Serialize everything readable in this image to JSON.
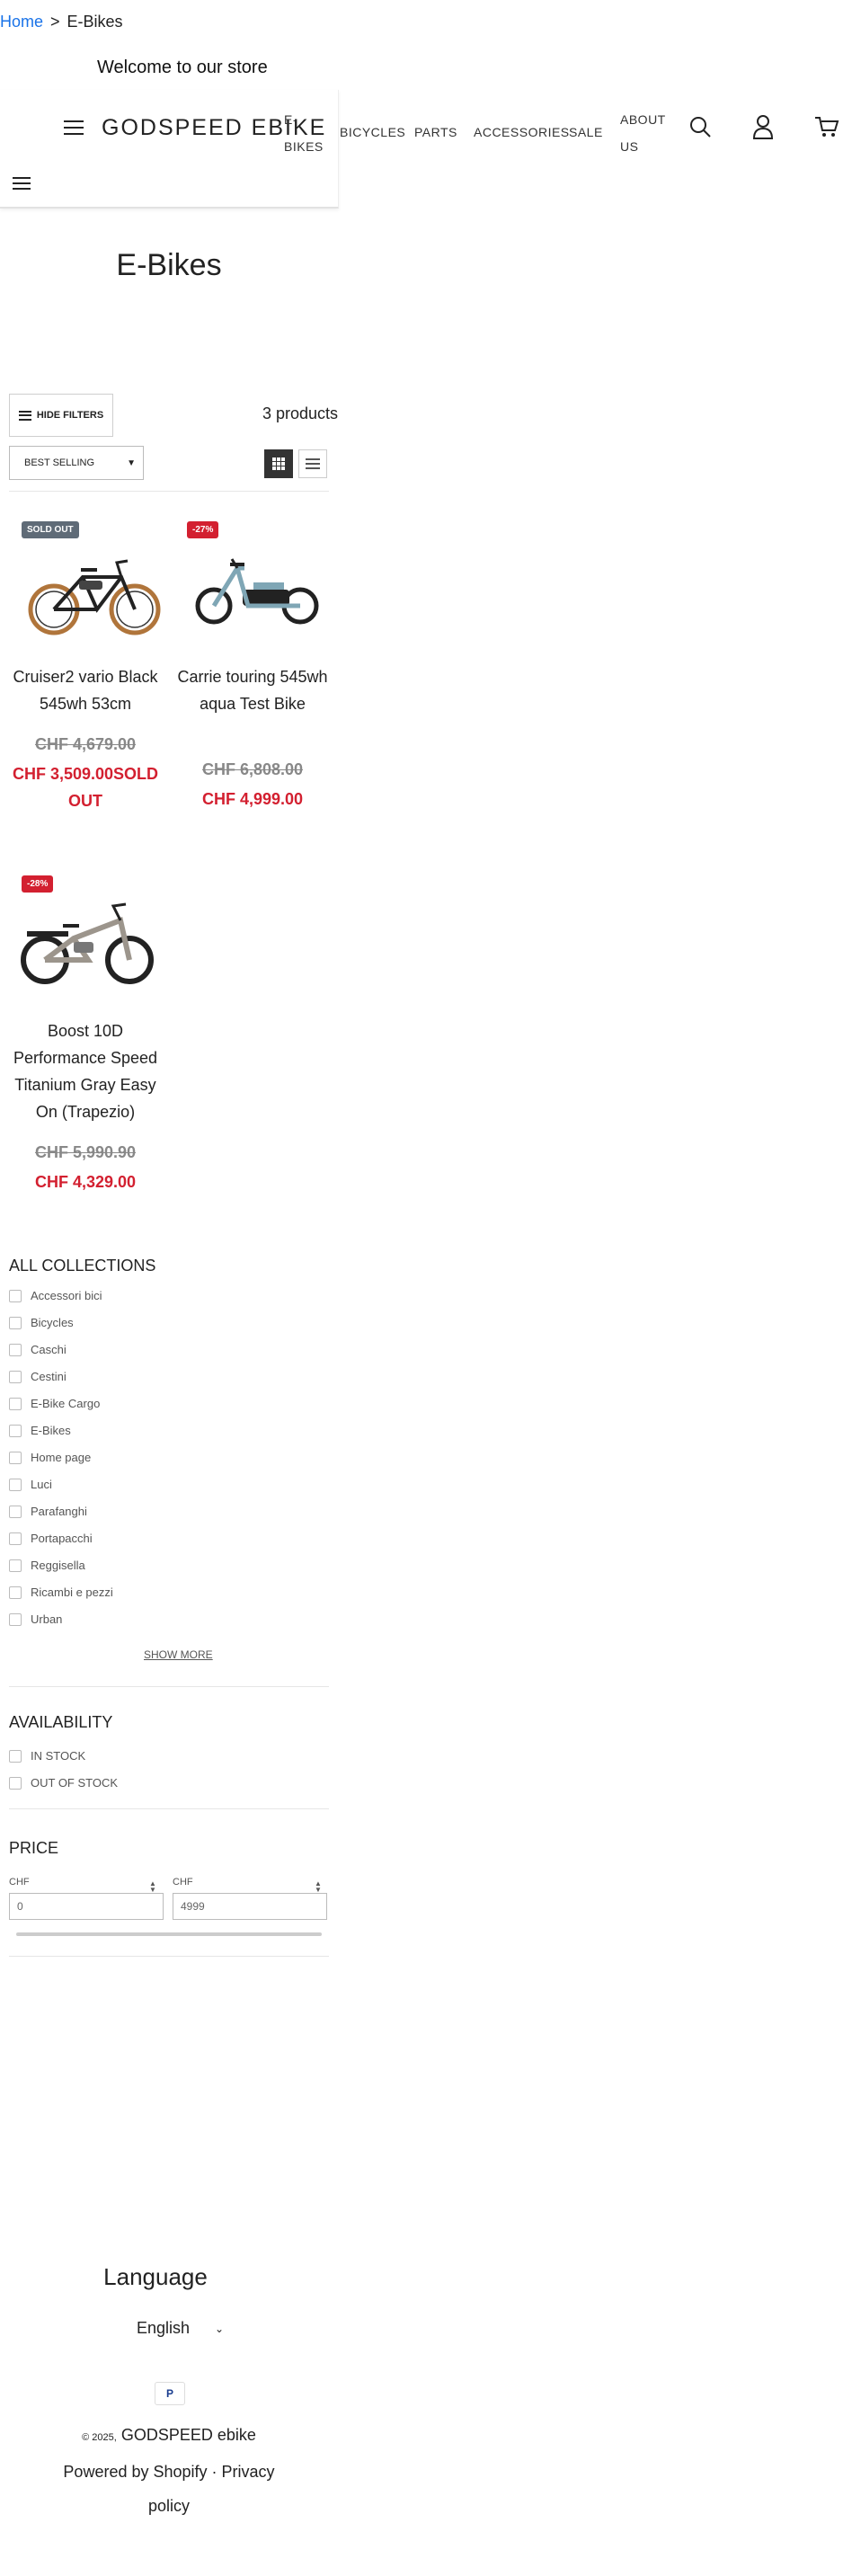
{
  "breadcrumb": {
    "home": "Home",
    "separator": ">",
    "current": "E-Bikes"
  },
  "announcement": "Welcome to our store",
  "header": {
    "logo": "GODSPEED EBIKE",
    "nav": [
      {
        "label": "E-\nBIKES"
      },
      {
        "label": "BICYCLES"
      },
      {
        "label": "PARTS"
      },
      {
        "label": "ACCESSORIES"
      },
      {
        "label": "SALE"
      },
      {
        "label": "ABOUT\nUS"
      }
    ],
    "icons": [
      "menu-icon",
      "search-icon",
      "account-icon",
      "cart-icon"
    ]
  },
  "page": {
    "title": "E-Bikes"
  },
  "toolbar": {
    "hide_filters": "HIDE FILTERS",
    "product_count": "3 products",
    "sort_selected": "BEST SELLING"
  },
  "products": [
    {
      "badge": "SOLD OUT",
      "badge_color": "#5f6b77",
      "name": "Cruiser2 vario Black 545wh 53cm",
      "old_price": "CHF 4,679.00",
      "new_price": "CHF 3,509.00SOLD OUT"
    },
    {
      "badge": "-27%",
      "badge_color": "#d32030",
      "name": "Carrie touring 545wh aqua Test Bike",
      "old_price": "CHF 6,808.00",
      "new_price": "CHF 4,999.00"
    },
    {
      "badge": "-28%",
      "badge_color": "#d32030",
      "name": "Boost 10D Performance Speed Titanium Gray Easy On (Trapezio)",
      "old_price": "CHF 5,990.90",
      "new_price": "CHF 4,329.00"
    }
  ],
  "filters": {
    "collections": {
      "heading": "ALL COLLECTIONS",
      "options": [
        "Accessori bici",
        "Bicycles",
        "Caschi",
        "Cestini",
        "E-Bike Cargo",
        "E-Bikes",
        "Home page",
        "Luci",
        "Parafanghi",
        "Portapacchi",
        "Reggisella",
        "Ricambi e pezzi",
        "Urban"
      ],
      "show_more": "SHOW MORE"
    },
    "availability": {
      "heading": "AVAILABILITY",
      "options": [
        "IN STOCK",
        "OUT OF STOCK"
      ]
    },
    "price": {
      "heading": "PRICE",
      "from_label": "CHF",
      "to_label": "CHF",
      "from_value": "0",
      "to_value": "4999"
    }
  },
  "footer": {
    "language_heading": "Language",
    "language_selected": "English",
    "payment_icon": "paypal-icon",
    "copyright_year": "© 2025,",
    "store_name": "GODSPEED ebike",
    "powered_by": "Powered by Shopify",
    "privacy": "Privacy policy"
  }
}
